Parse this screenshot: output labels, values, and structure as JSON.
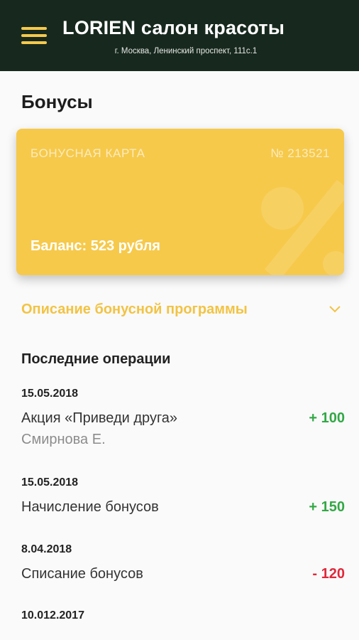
{
  "header": {
    "title": "LORIEN салон красоты",
    "address": "г. Москва, Ленинский проспект, 111с.1",
    "menu_icon": "hamburger-menu-icon",
    "background_color": "#17291e",
    "accent_color": "#f6c94b"
  },
  "page": {
    "title": "Бонусы"
  },
  "card": {
    "label": "БОНУСНАЯ КАРТА",
    "number": "№ 213521",
    "balance": "Баланс: 523 рубля",
    "color": "#f6c94b"
  },
  "program": {
    "label": "Описание бонусной программы",
    "icon": "chevron-down-icon"
  },
  "operations": {
    "title": "Последние операции",
    "items": [
      {
        "date": "15.05.2018",
        "title": "Акция «Приведи друга»",
        "subtitle": "Смирнова Е.",
        "amount": "+ 100"
      },
      {
        "date": "15.05.2018",
        "title": "Начисление бонусов",
        "amount": "+ 150"
      },
      {
        "date": "8.04.2018",
        "title": "Списание бонусов",
        "amount": "- 120"
      },
      {
        "date": "10.012.2017"
      }
    ]
  }
}
